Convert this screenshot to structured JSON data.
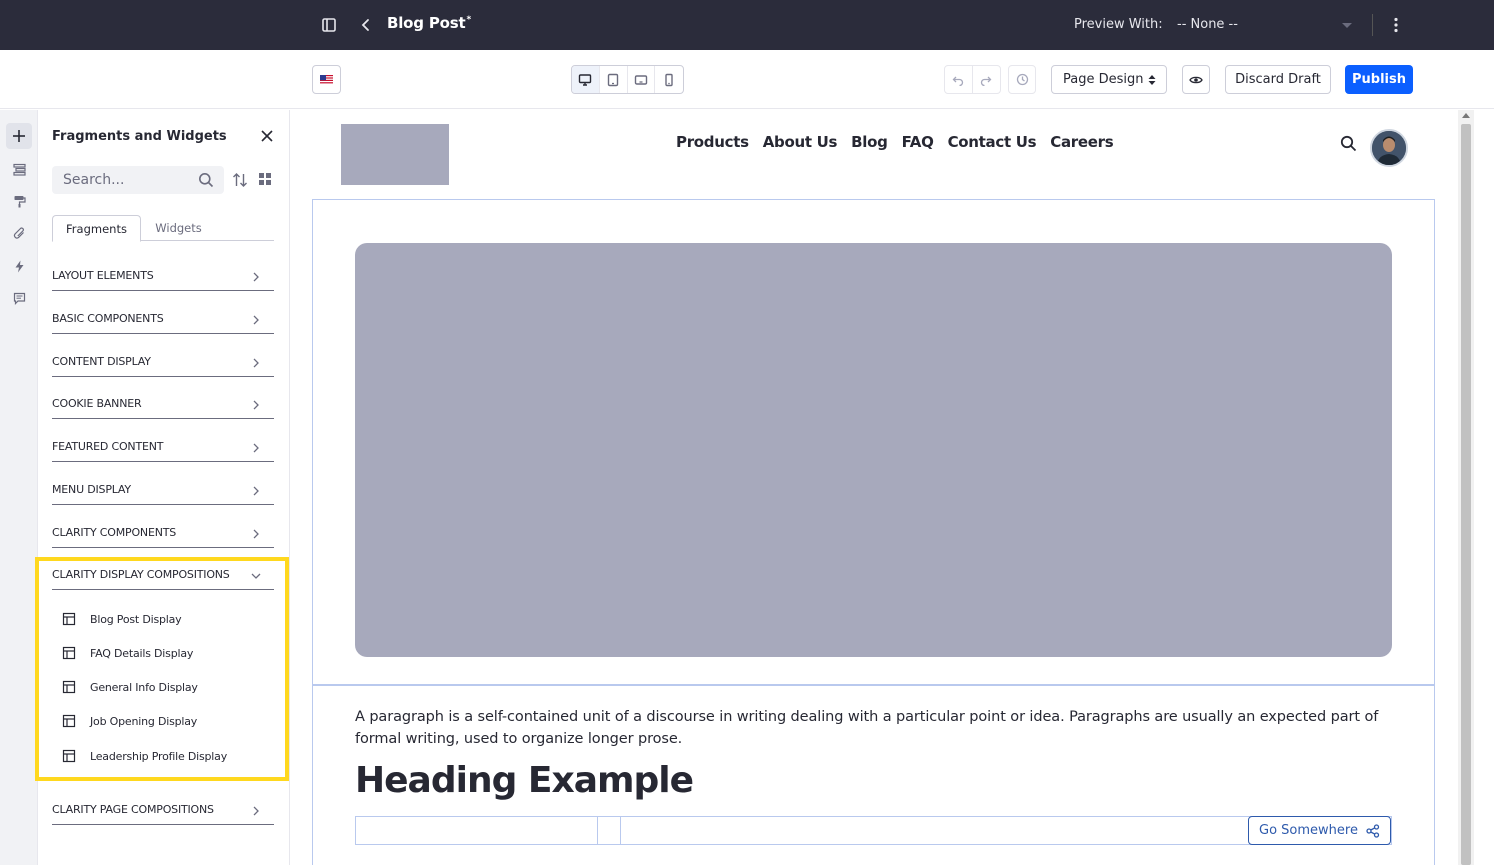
{
  "topbar": {
    "title": "Blog Post",
    "title_mark": "*",
    "preview_label": "Preview With:",
    "preview_value": "-- None --"
  },
  "toolbar": {
    "page_design_label": "Page Design",
    "discard_label": "Discard Draft",
    "publish_label": "Publish",
    "accent": "#0b5fff"
  },
  "panel": {
    "title": "Fragments and Widgets",
    "search_placeholder": "Search...",
    "tabs": [
      {
        "label": "Fragments",
        "active": true
      },
      {
        "label": "Widgets",
        "active": false
      }
    ],
    "categories": [
      {
        "label": "LAYOUT ELEMENTS"
      },
      {
        "label": "BASIC COMPONENTS"
      },
      {
        "label": "CONTENT DISPLAY"
      },
      {
        "label": "COOKIE BANNER"
      },
      {
        "label": "FEATURED CONTENT"
      },
      {
        "label": "MENU DISPLAY"
      },
      {
        "label": "CLARITY COMPONENTS"
      },
      {
        "label": "CLARITY DISPLAY COMPOSITIONS",
        "expanded": true
      },
      {
        "label": "CLARITY PAGE COMPOSITIONS"
      }
    ],
    "expanded_items": [
      {
        "label": "Blog Post Display"
      },
      {
        "label": "FAQ Details Display"
      },
      {
        "label": "General Info Display"
      },
      {
        "label": "Job Opening Display"
      },
      {
        "label": "Leadership Profile Display"
      }
    ],
    "highlight_color": "#ffd81e"
  },
  "canvas": {
    "nav": [
      "Products",
      "About Us",
      "Blog",
      "FAQ",
      "Contact Us",
      "Careers"
    ],
    "paragraph": "A paragraph is a self-contained unit of a discourse in writing dealing with a particular point or idea. Paragraphs are usually an expected part of formal writing, used to organize longer prose.",
    "heading": "Heading Example",
    "button_label": "Go Somewhere"
  }
}
